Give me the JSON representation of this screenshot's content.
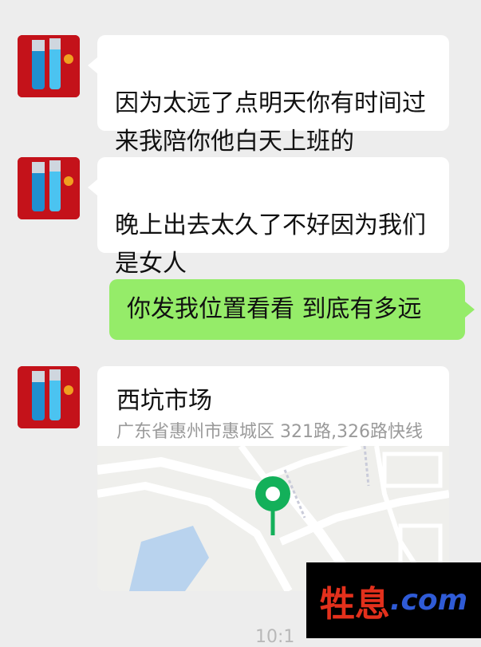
{
  "messages": [
    {
      "text": "因为太远了点明天你有时间过\n来我陪你他白天上班的"
    },
    {
      "text": "晚上出去太久了不好因为我们\n是女人"
    },
    {
      "text": "你发我位置看看 到底有多远"
    }
  ],
  "location": {
    "title": "西坑市场",
    "address": "广东省惠州市惠城区 321路,326路快线"
  },
  "watermark": {
    "cn": "牲息",
    "com": ".com"
  },
  "time": "10:1"
}
